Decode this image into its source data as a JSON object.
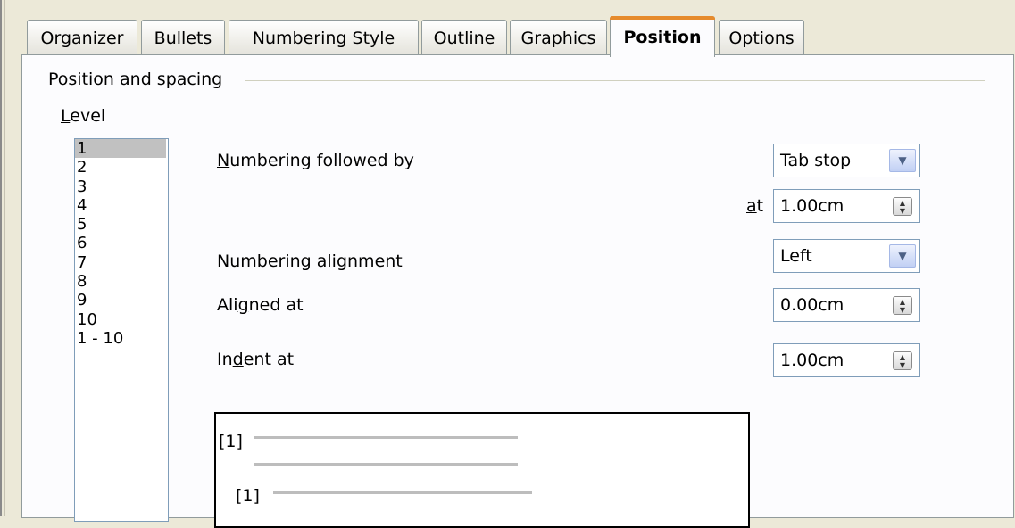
{
  "tabs": [
    {
      "label": "Organizer"
    },
    {
      "label": "Bullets"
    },
    {
      "label": "Numbering Style"
    },
    {
      "label": "Outline"
    },
    {
      "label": "Graphics"
    },
    {
      "label": "Position",
      "active": true
    },
    {
      "label": "Options"
    }
  ],
  "section": {
    "title": "Position and spacing"
  },
  "level": {
    "label": "Level",
    "items": [
      "1",
      "2",
      "3",
      "4",
      "5",
      "6",
      "7",
      "8",
      "9",
      "10",
      "1 - 10"
    ],
    "selected": "1"
  },
  "fields": {
    "numbering_followed_by": {
      "label": "Numbering followed by",
      "value": "Tab stop"
    },
    "at": {
      "label": "at",
      "value": "1.00cm"
    },
    "numbering_alignment": {
      "label": "Numbering alignment",
      "value": "Left"
    },
    "aligned_at": {
      "label": "Aligned at",
      "value": "0.00cm"
    },
    "indent_at": {
      "label": "Indent at",
      "value": "1.00cm"
    }
  },
  "preview": {
    "numbers": [
      "[1]",
      "[1]"
    ]
  },
  "icons": {
    "dropdown": "chevron-down-icon",
    "spin": "spin-arrows-icon"
  },
  "colors": {
    "active_tab_accent": "#e68b2c",
    "dialog_bg": "#ece9d8",
    "panel_bg": "#fcfcfe",
    "selection": "#c1c1c1"
  }
}
